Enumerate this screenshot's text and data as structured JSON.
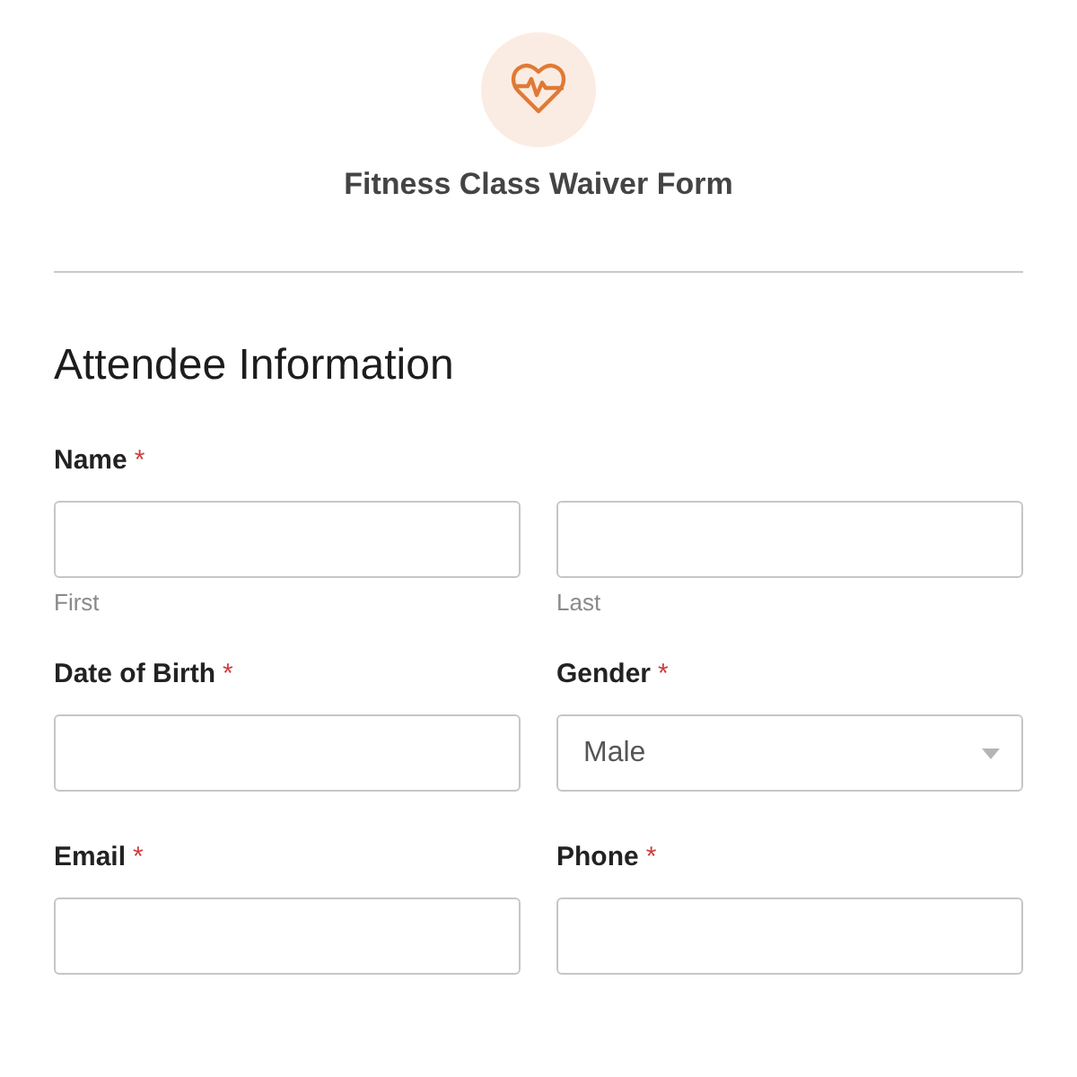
{
  "form": {
    "title": "Fitness Class Waiver Form"
  },
  "section": {
    "heading": "Attendee Information"
  },
  "fields": [
    {
      "kind": "name",
      "label": "Name",
      "required_mark": "*",
      "parts": [
        {
          "sublabel": "First"
        },
        {
          "sublabel": "Last"
        }
      ]
    },
    {
      "kind": "text",
      "label": "Date of Birth",
      "required_mark": "*"
    },
    {
      "kind": "select",
      "label": "Gender",
      "required_mark": "*",
      "value": "Male"
    },
    {
      "kind": "text",
      "label": "Email",
      "required_mark": "*"
    },
    {
      "kind": "text",
      "label": "Phone",
      "required_mark": "*"
    }
  ]
}
